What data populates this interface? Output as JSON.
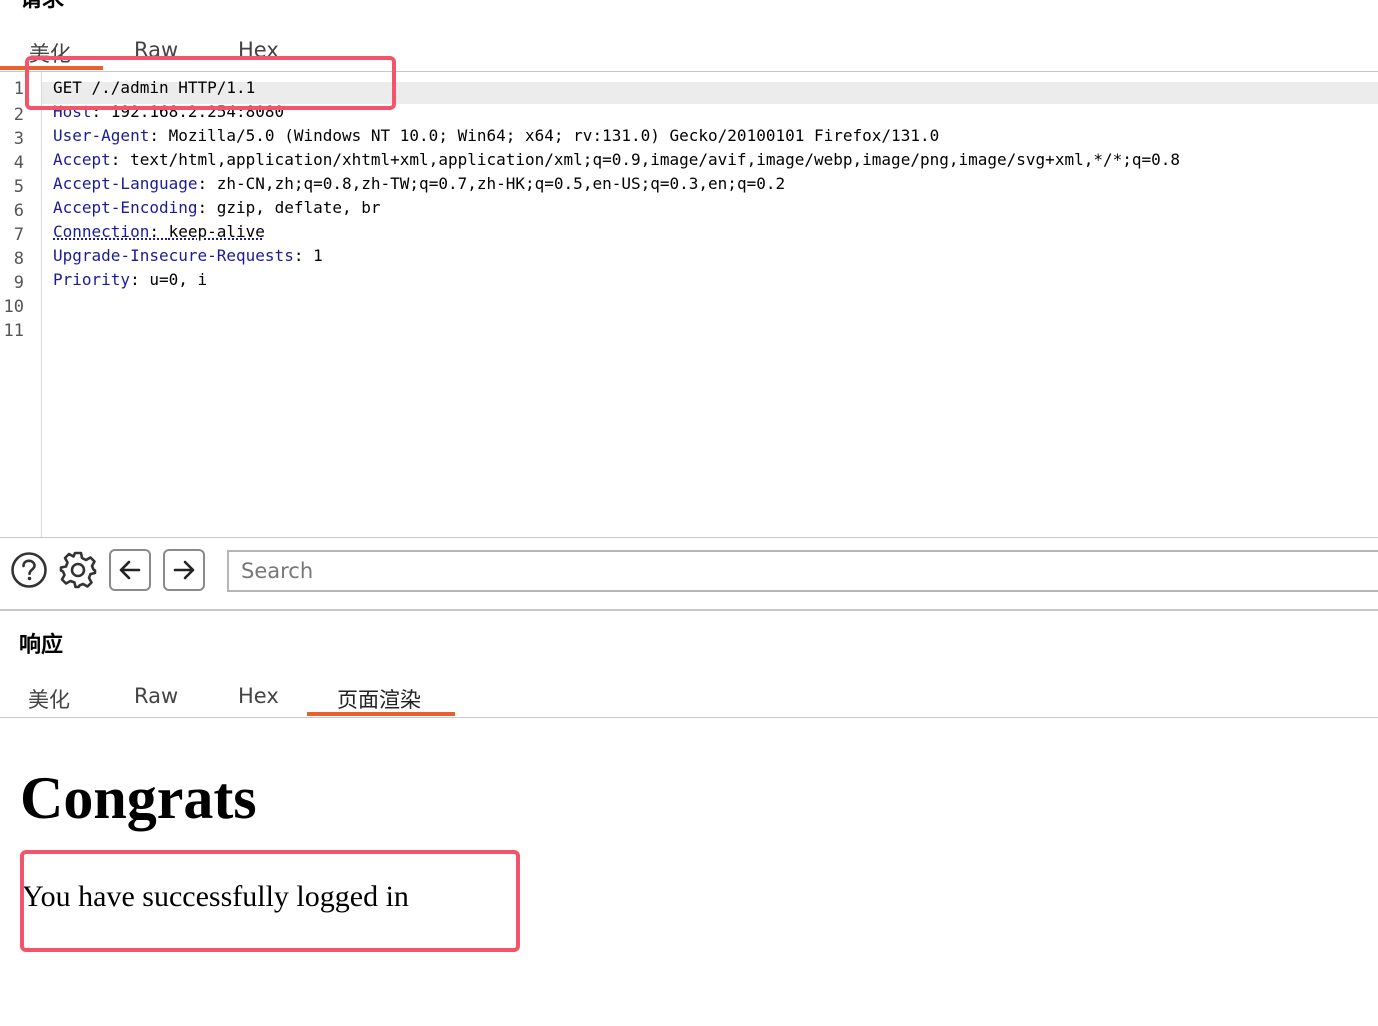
{
  "request": {
    "title": "请求",
    "tabs": [
      "美化",
      "Raw",
      "Hex"
    ],
    "active_tab": "美化",
    "lines": [
      {
        "num": "1",
        "text": "GET /./admin HTTP/1.1"
      },
      {
        "num": "2",
        "name": "Host",
        "value": "192.168.2.254:8080"
      },
      {
        "num": "3",
        "name": "User-Agent",
        "value": "Mozilla/5.0 (Windows NT 10.0; Win64; x64; rv:131.0) Gecko/20100101 Firefox/131.0"
      },
      {
        "num": "4",
        "name": "Accept",
        "value": "text/html,application/xhtml+xml,application/xml;q=0.9,image/avif,image/webp,image/png,image/svg+xml,*/*;q=0.8"
      },
      {
        "num": "5",
        "name": "Accept-Language",
        "value": "zh-CN,zh;q=0.8,zh-TW;q=0.7,zh-HK;q=0.5,en-US;q=0.3,en;q=0.2"
      },
      {
        "num": "6",
        "name": "Accept-Encoding",
        "value": "gzip, deflate, br"
      },
      {
        "num": "7",
        "name": "Connection",
        "value": "keep-alive"
      },
      {
        "num": "8",
        "name": "Upgrade-Insecure-Requests",
        "value": "1"
      },
      {
        "num": "9",
        "name": "Priority",
        "value": "u=0, i"
      },
      {
        "num": "10"
      },
      {
        "num": "11"
      }
    ]
  },
  "toolbar": {
    "help_icon": "help-circle-icon",
    "settings_icon": "gear-icon",
    "back_icon": "arrow-left-icon",
    "forward_icon": "arrow-right-icon",
    "search_placeholder": "Search"
  },
  "response": {
    "title": "响应",
    "tabs": [
      "美化",
      "Raw",
      "Hex",
      "页面渲染"
    ],
    "active_tab": "页面渲染",
    "heading": "Congrats",
    "message": "You have successfully logged in"
  },
  "colors": {
    "accent": "#e8612c",
    "highlight_box": "#f2546a",
    "header_name": "#1b1b9a"
  }
}
